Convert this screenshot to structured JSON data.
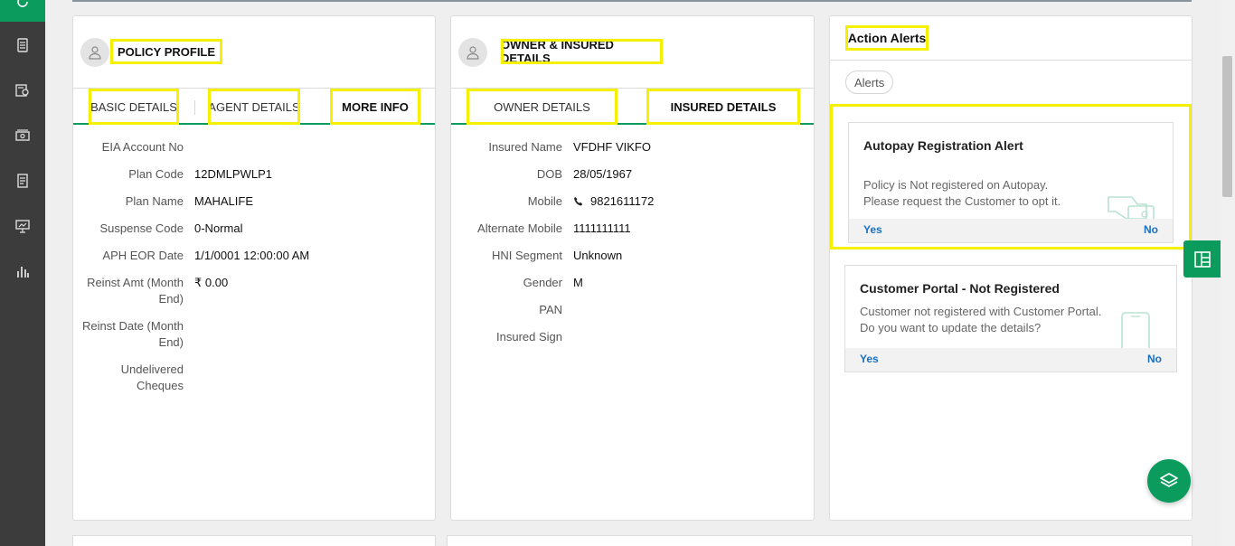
{
  "sidebar": {
    "icons": [
      "refresh-icon",
      "document-icon",
      "policy-search-icon",
      "money-icon",
      "receipt-icon",
      "presentation-icon",
      "bar-chart-icon"
    ]
  },
  "policy_profile": {
    "title": "POLICY PROFILE",
    "tabs": [
      {
        "label": "BASIC DETAILS",
        "active": false
      },
      {
        "label": "AGENT DETAILS",
        "active": false
      },
      {
        "label": "MORE INFO",
        "active": true
      }
    ],
    "fields": [
      {
        "label": "EIA Account No",
        "value": ""
      },
      {
        "label": "Plan Code",
        "value": "12DMLPWLP1"
      },
      {
        "label": "Plan Name",
        "value": "MAHALIFE"
      },
      {
        "label": "Suspense Code",
        "value": "0-Normal"
      },
      {
        "label": "APH EOR Date",
        "value": "1/1/0001 12:00:00 AM"
      },
      {
        "label": "Reinst Amt (Month End)",
        "value": "₹ 0.00"
      },
      {
        "label": "Reinst Date (Month End)",
        "value": ""
      },
      {
        "label": "Undelivered Cheques",
        "value": ""
      }
    ]
  },
  "owner_insured": {
    "title": "OWNER & INSURED DETAILS",
    "tabs": [
      {
        "label": "OWNER DETAILS",
        "active": false
      },
      {
        "label": "INSURED DETAILS",
        "active": true
      }
    ],
    "fields": [
      {
        "label": "Insured Name",
        "value": "VFDHF VIKFO"
      },
      {
        "label": "DOB",
        "value": "28/05/1967"
      },
      {
        "label": "Mobile",
        "value": "9821611172",
        "icon": "phone-icon"
      },
      {
        "label": "Alternate Mobile",
        "value": "1111111111"
      },
      {
        "label": "HNI Segment",
        "value": "Unknown"
      },
      {
        "label": "Gender",
        "value": "M"
      },
      {
        "label": "PAN",
        "value": ""
      },
      {
        "label": "Insured Sign",
        "value": ""
      }
    ]
  },
  "action_alerts": {
    "title": "Action Alerts",
    "filter_pill": "Alerts",
    "alerts": [
      {
        "title": "Autopay Registration Alert",
        "lines": [
          "Policy is Not registered on Autopay.",
          "Please request the Customer to opt it."
        ],
        "yes": "Yes",
        "no": "No",
        "icon": "card-hand-icon"
      },
      {
        "title": "Customer Portal - Not Registered",
        "lines": [
          "Customer not registered with Customer Portal.",
          "Do you want to update the details?"
        ],
        "yes": "Yes",
        "no": "No",
        "icon": "mobile-phone-icon"
      }
    ]
  },
  "colors": {
    "accent": "#0b9b5d",
    "highlight": "#f5f000",
    "sidebar": "#3c3c3c",
    "link": "#1a6fbf"
  }
}
